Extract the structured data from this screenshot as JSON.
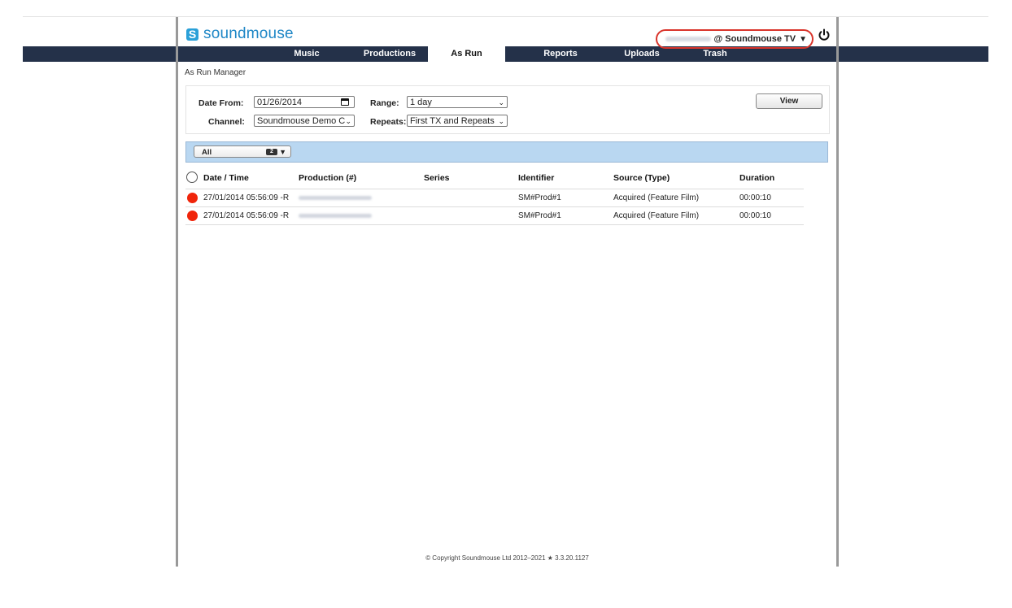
{
  "brand": {
    "name": "soundmouse",
    "icon": "soundmouse-logo-icon"
  },
  "user": {
    "org": "@ Soundmouse TV",
    "caret": "▼",
    "power_icon": "power-icon"
  },
  "nav": {
    "tabs": [
      {
        "label": "Music"
      },
      {
        "label": "Productions"
      },
      {
        "label": "As Run"
      },
      {
        "label": "Reports"
      },
      {
        "label": "Uploads"
      },
      {
        "label": "Trash"
      }
    ],
    "active": "As Run"
  },
  "breadcrumb": "As Run Manager",
  "filters": {
    "date_from_label": "Date From:",
    "date_from_value": "01/26/2014",
    "range_label": "Range:",
    "range_value": "1 day",
    "channel_label": "Channel:",
    "channel_value": "Soundmouse Demo C",
    "repeats_label": "Repeats:",
    "repeats_value": "First TX and Repeats",
    "view_button": "View"
  },
  "filter_bar": {
    "all_label": "All",
    "count": "2",
    "caret": "▼"
  },
  "table": {
    "headers": [
      "Date / Time",
      "Production (#)",
      "Series",
      "Identifier",
      "Source (Type)",
      "Duration"
    ],
    "rows": [
      {
        "datetime": "27/01/2014 05:56:09 -R",
        "identifier": "SM#Prod#1",
        "source": "Acquired (Feature Film)",
        "duration": "00:00:10"
      },
      {
        "datetime": "27/01/2014 05:56:09 -R",
        "identifier": "SM#Prod#1",
        "source": "Acquired (Feature Film)",
        "duration": "00:00:10"
      }
    ]
  },
  "footer": "© Copyright Soundmouse Ltd 2012–2021 ★ 3.3.20.1127",
  "colors": {
    "nav_bg": "#243149",
    "brand": "#1f87c6",
    "status_red": "#f0250b",
    "filter_bar": "#b9d7f1",
    "highlight_ring": "#d9342b"
  }
}
